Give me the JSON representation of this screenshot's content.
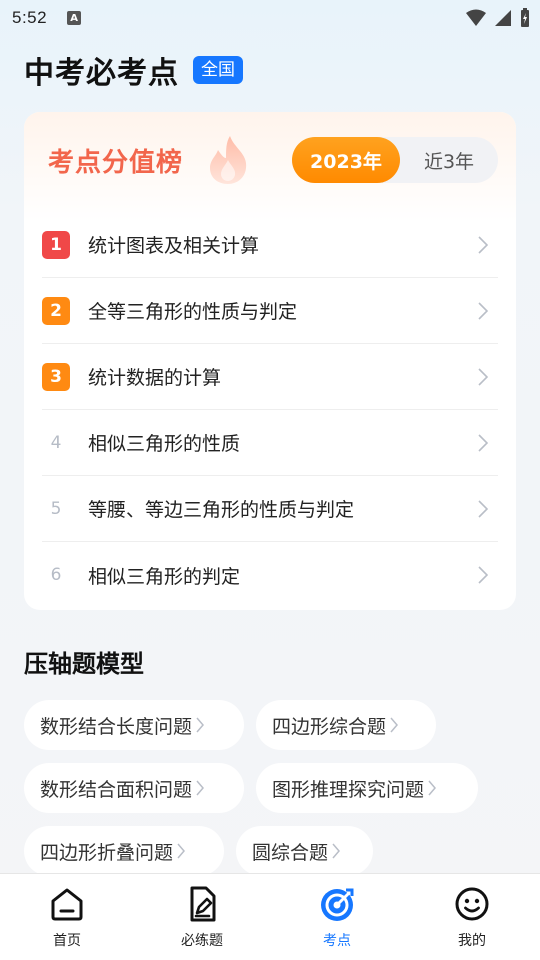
{
  "status_bar": {
    "time": "5:52",
    "notification_icon": "A"
  },
  "header": {
    "title": "中考必考点",
    "region_badge": "全国"
  },
  "ranking": {
    "title": "考点分值榜",
    "year_tabs": [
      "2023年",
      "近3年"
    ],
    "active_tab": "2023年",
    "items": [
      {
        "rank": "1",
        "label": "统计图表及相关计算"
      },
      {
        "rank": "2",
        "label": "全等三角形的性质与判定"
      },
      {
        "rank": "3",
        "label": "统计数据的计算"
      },
      {
        "rank": "4",
        "label": "相似三角形的性质"
      },
      {
        "rank": "5",
        "label": "等腰、等边三角形的性质与判定"
      },
      {
        "rank": "6",
        "label": "相似三角形的判定"
      }
    ]
  },
  "models": {
    "title": "压轴题模型",
    "chips": [
      "数形结合长度问题",
      "四边形综合题",
      "数形结合面积问题",
      "图形推理探究问题",
      "四边形折叠问题",
      "圆综合题"
    ]
  },
  "bottom_nav": {
    "items": [
      {
        "label": "首页",
        "icon": "home-icon"
      },
      {
        "label": "必练题",
        "icon": "edit-document-icon"
      },
      {
        "label": "考点",
        "icon": "target-icon"
      },
      {
        "label": "我的",
        "icon": "smiley-icon"
      }
    ],
    "active": "考点"
  },
  "colors": {
    "accent": "#1677ff",
    "rank_title": "#f2664c",
    "rank_1": "#f04848",
    "rank_2_3": "#ff8a12",
    "toggle_active": "#ff9a12"
  }
}
